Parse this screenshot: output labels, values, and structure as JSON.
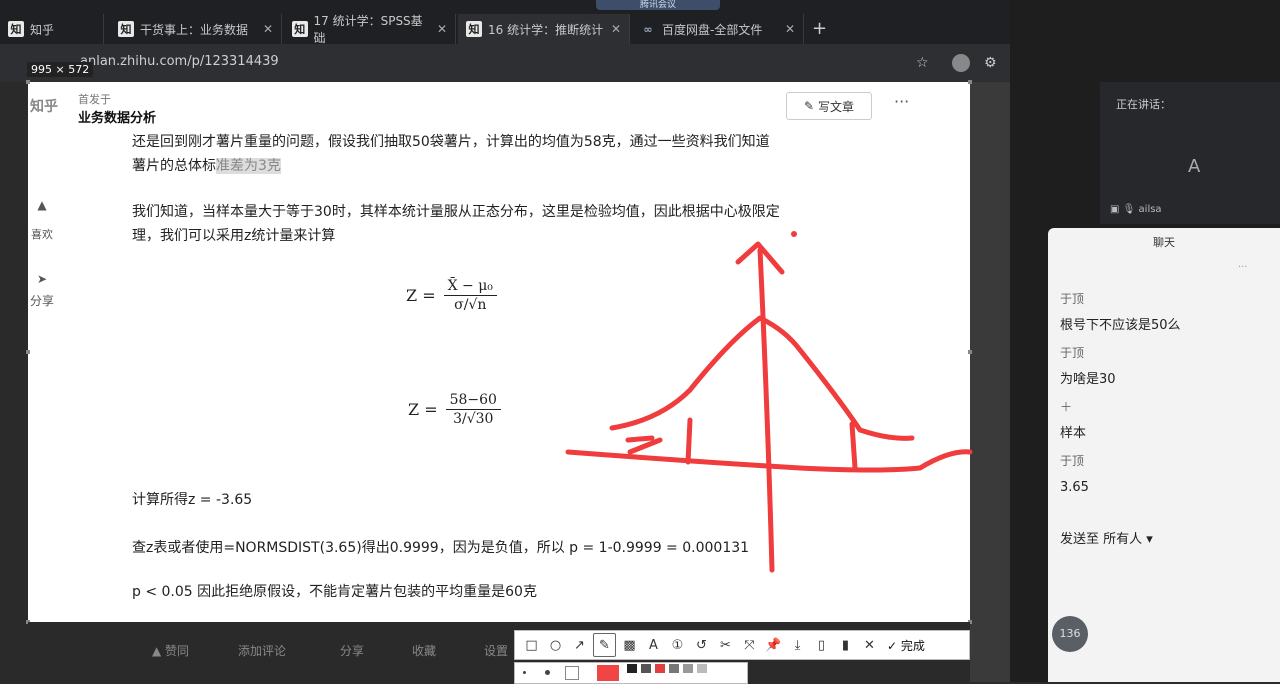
{
  "browser": {
    "tabs": [
      {
        "icon": "知",
        "title": "知乎"
      },
      {
        "icon": "知",
        "title": "干货事上：业务数据"
      },
      {
        "icon": "知",
        "title": "17 统计学：SPSS基础"
      },
      {
        "icon": "知",
        "title": "16 统计学：推断统计"
      },
      {
        "icon": "∞",
        "title": "百度网盘-全部文件"
      }
    ],
    "new_tab": "+",
    "meeting_pill": "腾讯会议",
    "url": "anlan.zhihu.com/p/123314439",
    "capture_size": "995 × 572"
  },
  "article": {
    "logo": "知乎",
    "published_in": "首发于",
    "column": "业务数据分析",
    "write_button": "写文章",
    "more": "···",
    "side": {
      "like": "喜欢",
      "share": "分享"
    },
    "para1": "还是回到刚才薯片重量的问题，假设我们抽取50袋薯片，计算出的均值为58克，通过一些资料我们知道薯片的总体标",
    "para1_hl": "准差为3克",
    "para2": "我们知道，当样本量大于等于30时，其样本统计量服从正态分布，这里是检验均值，因此根据中心极限定理，我们可以采用z统计量来计算",
    "formula1": {
      "lhs": "Z =",
      "num": "X̄ − μ₀",
      "den": "σ/√n"
    },
    "formula2": {
      "lhs": "Z =",
      "num": "58−60",
      "den": "3/√30"
    },
    "result": "计算所得z = -3.65",
    "lookup": "查z表或者使用=NORMSDIST(3.65)得出0.9999，因为是负值，所以 p = 1-0.9999 = 0.000131",
    "conclusion": "p < 0.05 因此拒绝原假设，不能肯定薯片包装的平均重量是60克",
    "actions": [
      "▲ 赞同",
      "添加评论",
      "分享",
      "收藏",
      "设置"
    ]
  },
  "annotation_toolbar": {
    "tools": [
      "□",
      "○",
      "↗",
      "✎",
      "▩",
      "A",
      "①",
      "↺",
      "✂",
      "⤧",
      "📌",
      "⤓",
      "▯",
      "▮",
      "✕"
    ],
    "done": "✓ 完成",
    "colors": [
      "#f04545",
      "#222222",
      "#555555",
      "#e04040",
      "#777777",
      "#999999",
      "#bbbbbb"
    ]
  },
  "meeting": {
    "speaking": "正在讲话：",
    "avatar_letter": "A",
    "speaker": "ailsa",
    "chat_title": "聊天",
    "chat_more": "···",
    "messages": [
      {
        "name": "于顶",
        "text": "根号下不应该是50么"
      },
      {
        "name": "于顶",
        "text": "为啥是30"
      },
      {
        "name": "＋",
        "text": "样本"
      },
      {
        "name": "于顶",
        "text": "3.65"
      }
    ],
    "send_to": "发送至 所有人 ▾",
    "avatar_initials": "136"
  }
}
